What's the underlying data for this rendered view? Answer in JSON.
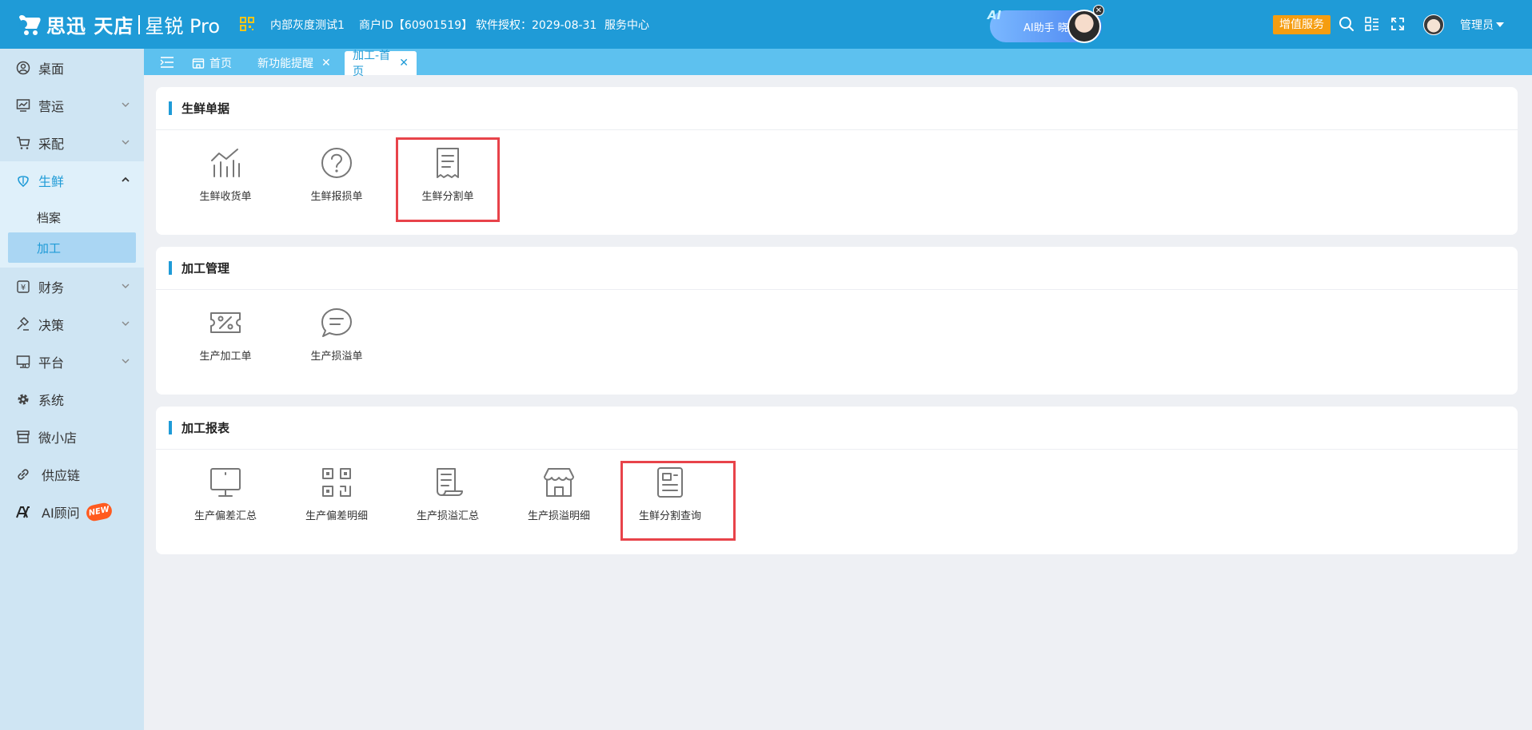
{
  "header": {
    "logo_text": "思迅 天店",
    "logo_product": "星锐 Pro",
    "org_name": "内部灰度测试1",
    "merchant_id": "商户ID【60901519】",
    "license": "软件授权：2029-08-31",
    "service_center": "服务中心",
    "ai_badge": "AI",
    "ai_assistant": "AI助手 晓雨",
    "ai_close": "✕",
    "vas_label": "增值服务",
    "user_label": "管理员",
    "icons": [
      "search-icon",
      "grid-menu-icon",
      "fullscreen-icon"
    ],
    "accent_color": "#1f9bd7"
  },
  "sidebar": {
    "items": [
      {
        "label": "桌面",
        "icon": "dashboard-icon"
      },
      {
        "label": "营运",
        "icon": "operations-icon"
      },
      {
        "label": "采配",
        "icon": "cart-icon"
      },
      {
        "label": "生鲜",
        "icon": "fresh-icon"
      },
      {
        "label": "财务",
        "icon": "finance-icon"
      },
      {
        "label": "决策",
        "icon": "decision-icon"
      },
      {
        "label": "平台",
        "icon": "platform-icon"
      },
      {
        "label": "系统",
        "icon": "gear-icon"
      },
      {
        "label": "微小店",
        "icon": "shop-icon"
      },
      {
        "label": "供应链",
        "icon": "link-icon"
      },
      {
        "label": "AI顾问",
        "icon": "ai-icon",
        "badge": "NEW"
      }
    ],
    "fresh_sub": [
      {
        "label": "档案"
      },
      {
        "label": "加工"
      }
    ]
  },
  "tabs": [
    {
      "label": "首页"
    },
    {
      "label": "新功能提醒"
    },
    {
      "label": "加工-首页"
    }
  ],
  "tab_close": "✕",
  "sections": [
    {
      "title": "生鲜单据",
      "items": [
        {
          "label": "生鲜收货单",
          "icon": "chart-icon"
        },
        {
          "label": "生鲜报损单",
          "icon": "question-icon"
        },
        {
          "label": "生鲜分割单",
          "icon": "receipt-icon"
        }
      ]
    },
    {
      "title": "加工管理",
      "items": [
        {
          "label": "生产加工单",
          "icon": "coupon-icon"
        },
        {
          "label": "生产损溢单",
          "icon": "chat-icon"
        }
      ]
    },
    {
      "title": "加工报表",
      "items": [
        {
          "label": "生产偏差汇总",
          "icon": "monitor-icon"
        },
        {
          "label": "生产偏差明细",
          "icon": "qr-icon"
        },
        {
          "label": "生产损溢汇总",
          "icon": "scroll-icon"
        },
        {
          "label": "生产损溢明细",
          "icon": "store-icon"
        },
        {
          "label": "生鲜分割查询",
          "icon": "document-icon"
        }
      ]
    }
  ],
  "highlight_color": "#e8434a"
}
